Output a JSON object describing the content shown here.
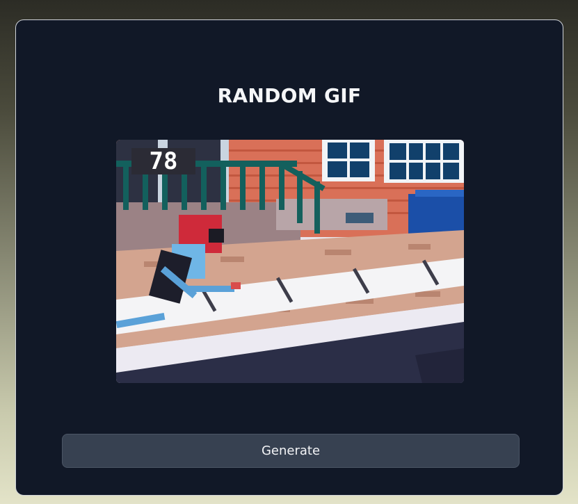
{
  "app": {
    "title": "RANDOM GIF"
  },
  "gif": {
    "score_text": "78",
    "image_icon": "pixel-art-street-scene-image"
  },
  "actions": {
    "generate_label": "Generate"
  },
  "colors": {
    "card_background": "#111827",
    "button_background": "#374151",
    "title_text": "#f5f6f8"
  }
}
